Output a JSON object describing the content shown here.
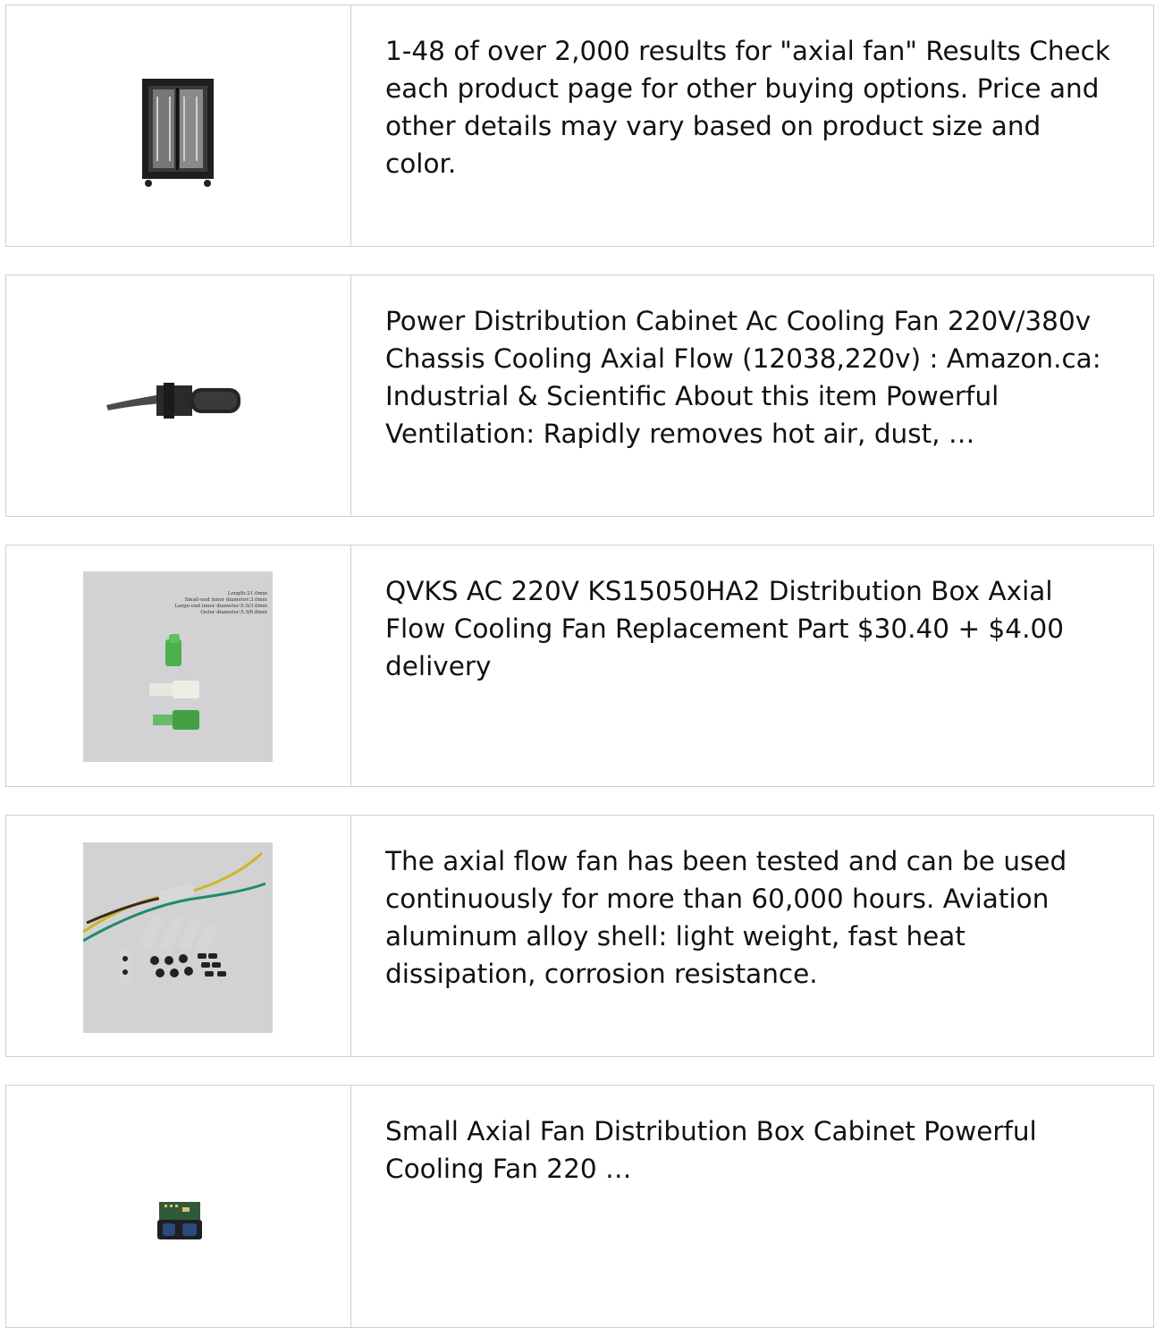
{
  "results": [
    {
      "image": "server-rack-cabinet",
      "text": "1-48 of over 2,000 results for \"axial fan\" Results Check each product page for other buying options. Price and other details may vary based on product size and color."
    },
    {
      "image": "black-bracket-clip",
      "text": "Power Distribution Cabinet Ac Cooling Fan 220V/380v Chassis Cooling Axial Flow (12038,220v) : Amazon.ca: Industrial & Scientific About this item Powerful Ventilation: Rapidly removes hot air, dust, …"
    },
    {
      "image": "fiber-connector-boots",
      "text": "QVKS AC 220V KS15050HA2 Distribution Box Axial Flow Cooling Fan Replacement Part $30.40 + $4.00 delivery",
      "image_labels": [
        "Length:21.0mm",
        "Small-end inner diameter:3.0mm",
        "Large-end inner diameter:5.0/3.0mm",
        "Outer diameter:5.9/6.8mm"
      ]
    },
    {
      "image": "wire-ferrule-kit",
      "text": "The axial flow fan has been tested and can be used continuously for more than 60,000 hours. Aviation aluminum alloy shell: light weight, fast heat dissipation, corrosion resistance."
    },
    {
      "image": "laser-sensor-module",
      "text": "Small Axial Fan Distribution Box Cabinet Powerful Cooling Fan 220 …"
    }
  ]
}
